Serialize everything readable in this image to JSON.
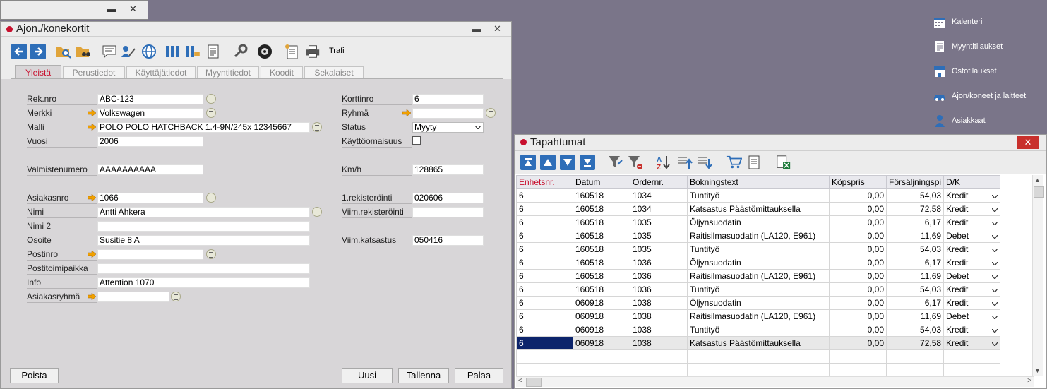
{
  "bg_window": {
    "min": "▬",
    "close": "✕"
  },
  "sidebar": [
    {
      "label": "Kalenteri",
      "icon": "calendar-icon"
    },
    {
      "label": "Myyntitilaukset",
      "icon": "document-icon"
    },
    {
      "label": "Ostotilaukset",
      "icon": "store-icon"
    },
    {
      "label": "Ajon/koneet ja laitteet",
      "icon": "car-icon"
    },
    {
      "label": "Asiakkaat",
      "icon": "person-icon"
    }
  ],
  "card": {
    "title": "Ajon./konekortit",
    "min": "▬",
    "close": "✕",
    "toolbar": {
      "trafi": "Trafi"
    },
    "tabs": [
      "Yleistä",
      "Perustiedot",
      "Käyttäjätiedot",
      "Myyntitiedot",
      "Koodit",
      "Sekalaiset"
    ],
    "left": {
      "reknro": {
        "label": "Rek.nro",
        "value": "ABC-123"
      },
      "merkki": {
        "label": "Merkki",
        "value": "Volkswagen"
      },
      "malli": {
        "label": "Malli",
        "value": "POLO POLO HATCHBACK 1.4-9N/245x 12345667"
      },
      "vuosi": {
        "label": "Vuosi",
        "value": "2006"
      },
      "valmistenumero": {
        "label": "Valmistenumero",
        "value": "AAAAAAAAAA"
      },
      "asiakasnro": {
        "label": "Asiakasnro",
        "value": "1066"
      },
      "nimi": {
        "label": "Nimi",
        "value": "Antti Ahkera"
      },
      "nimi2": {
        "label": "Nimi 2",
        "value": ""
      },
      "osoite": {
        "label": "Osoite",
        "value": "Susitie 8 A"
      },
      "postinro": {
        "label": "Postinro",
        "value": ""
      },
      "postitoimipaikka": {
        "label": "Postitoimipaikka",
        "value": ""
      },
      "info": {
        "label": "Info",
        "value": "Attention 1070"
      },
      "asiakasryhma": {
        "label": "Asiakasryhmä",
        "value": ""
      }
    },
    "right": {
      "korttinro": {
        "label": "Korttinro",
        "value": "6"
      },
      "ryhma": {
        "label": "Ryhmä",
        "value": ""
      },
      "status": {
        "label": "Status",
        "value": "Myyty"
      },
      "kayttoomaisuus": {
        "label": "Käyttöomaisuus"
      },
      "kmh": {
        "label": "Km/h",
        "value": "128865"
      },
      "rekisterointi1": {
        "label": "1.rekisteröinti",
        "value": "020606"
      },
      "viimrekisterointi": {
        "label": "Viim.rekisteröinti",
        "value": ""
      },
      "viimkatsastus": {
        "label": "Viim.katsastus",
        "value": "050416"
      }
    },
    "buttons": {
      "poista": "Poista",
      "uusi": "Uusi",
      "tallenna": "Tallenna",
      "palaa": "Palaa"
    }
  },
  "events": {
    "title": "Tapahtumat",
    "close": "✕",
    "columns": [
      "Enhetsnr.",
      "Datum",
      "Ordernr.",
      "Bokningstext",
      "Köpspris",
      "Försäljningspi",
      "D/K"
    ],
    "rows": [
      [
        "6",
        "160518",
        "1034",
        "Tuntityö",
        "0,00",
        "54,03",
        "Kredit"
      ],
      [
        "6",
        "160518",
        "1034",
        "Katsastus Päästömittauksella",
        "0,00",
        "72,58",
        "Kredit"
      ],
      [
        "6",
        "160518",
        "1035",
        "Öljynsuodatin",
        "0,00",
        "6,17",
        "Kredit"
      ],
      [
        "6",
        "160518",
        "1035",
        "Raitisilmasuodatin (LA120, E961)",
        "0,00",
        "11,69",
        "Debet"
      ],
      [
        "6",
        "160518",
        "1035",
        "Tuntityö",
        "0,00",
        "54,03",
        "Kredit"
      ],
      [
        "6",
        "160518",
        "1036",
        "Öljynsuodatin",
        "0,00",
        "6,17",
        "Kredit"
      ],
      [
        "6",
        "160518",
        "1036",
        "Raitisilmasuodatin (LA120, E961)",
        "0,00",
        "11,69",
        "Debet"
      ],
      [
        "6",
        "160518",
        "1036",
        "Tuntityö",
        "0,00",
        "54,03",
        "Kredit"
      ],
      [
        "6",
        "060918",
        "1038",
        "Öljynsuodatin",
        "0,00",
        "6,17",
        "Kredit"
      ],
      [
        "6",
        "060918",
        "1038",
        "Raitisilmasuodatin (LA120, E961)",
        "0,00",
        "11,69",
        "Debet"
      ],
      [
        "6",
        "060918",
        "1038",
        "Tuntityö",
        "0,00",
        "54,03",
        "Kredit"
      ],
      [
        "6",
        "060918",
        "1038",
        "Katsastus Päästömittauksella",
        "0,00",
        "72,58",
        "Kredit"
      ]
    ]
  },
  "colors": {
    "accent_red": "#c8102e",
    "toolbar_blue": "#2e6eb8",
    "selection": "#0c246b",
    "desktop": "#7a7589"
  }
}
